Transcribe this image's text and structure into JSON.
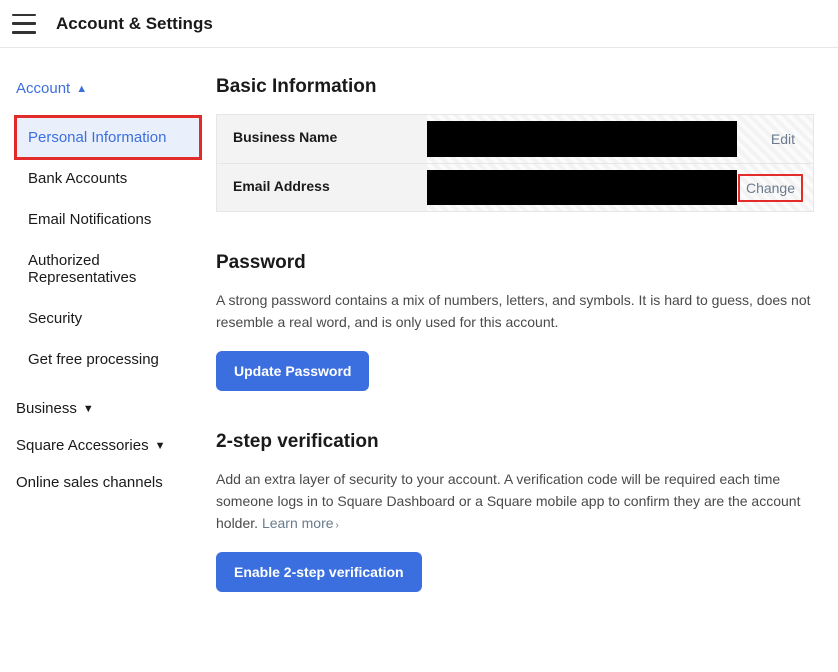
{
  "topbar": {
    "title": "Account & Settings"
  },
  "sidebar": {
    "sections": [
      {
        "header": "Account",
        "expanded": true,
        "items": [
          {
            "label": "Personal Information",
            "active": true
          },
          {
            "label": "Bank Accounts"
          },
          {
            "label": "Email Notifications"
          },
          {
            "label": "Authorized Representatives"
          },
          {
            "label": "Security"
          },
          {
            "label": "Get free processing"
          }
        ]
      },
      {
        "header": "Business",
        "expanded": false
      },
      {
        "header": "Square Accessories",
        "expanded": false
      },
      {
        "header": "Online sales channels",
        "expanded": false,
        "no_chevron": true
      }
    ]
  },
  "basic_info": {
    "title": "Basic Information",
    "rows": [
      {
        "label": "Business Name",
        "action": "Edit"
      },
      {
        "label": "Email Address",
        "action": "Change",
        "action_highlight": true
      }
    ]
  },
  "password": {
    "title": "Password",
    "desc": "A strong password contains a mix of numbers, letters, and symbols. It is hard to guess, does not resemble a real word, and is only used for this account.",
    "button": "Update Password"
  },
  "twostep": {
    "title": "2-step verification",
    "desc": "Add an extra layer of security to your account. A verification code will be required each time someone logs in to Square Dashboard or a Square mobile app to confirm they are the account holder. ",
    "learn_more": "Learn more",
    "button": "Enable 2-step verification"
  }
}
